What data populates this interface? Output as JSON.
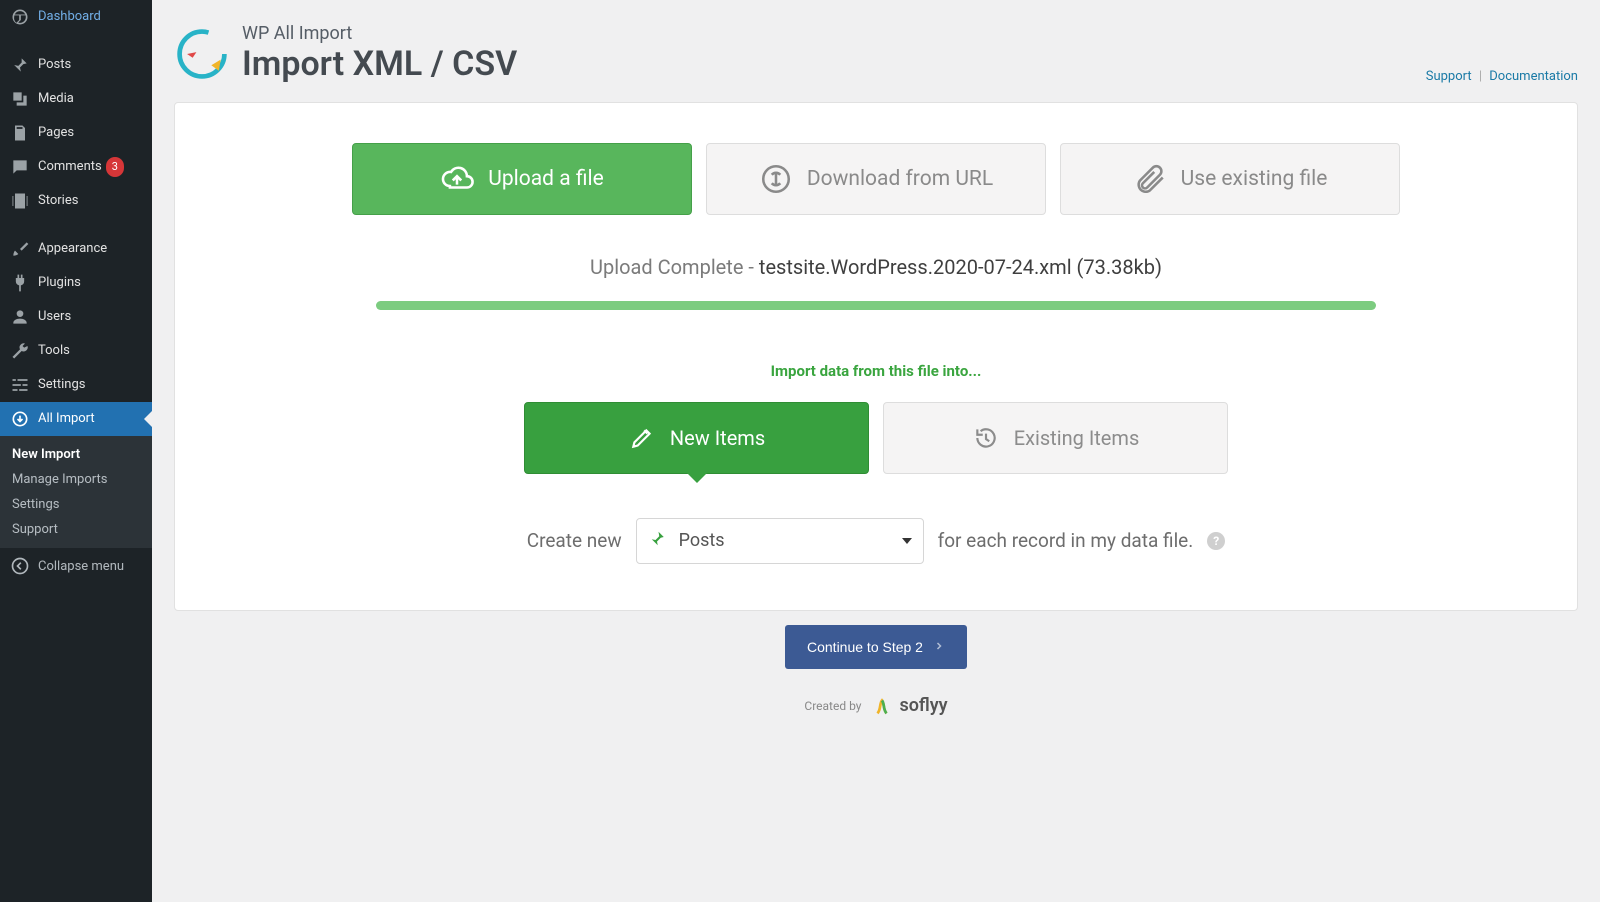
{
  "sidebar": {
    "dashboard": "Dashboard",
    "posts": "Posts",
    "media": "Media",
    "pages": "Pages",
    "comments": "Comments",
    "comments_count": "3",
    "stories": "Stories",
    "appearance": "Appearance",
    "plugins": "Plugins",
    "users": "Users",
    "tools": "Tools",
    "settings": "Settings",
    "all_import": "All Import",
    "sub_new_import": "New Import",
    "sub_manage": "Manage Imports",
    "sub_settings": "Settings",
    "sub_support": "Support",
    "collapse": "Collapse menu"
  },
  "header": {
    "eyebrow": "WP All Import",
    "title": "Import XML / CSV",
    "support": "Support",
    "documentation": "Documentation"
  },
  "tabs": {
    "upload": "Upload a file",
    "download": "Download from URL",
    "existing": "Use existing file"
  },
  "upload": {
    "status_label": "Upload Complete",
    "file_name": "testsite.WordPress.2020-07-24.xml",
    "file_size": "73.38kb",
    "progress_percent": 100
  },
  "into": {
    "label": "Import data from this file into...",
    "new_items": "New Items",
    "existing_items": "Existing Items"
  },
  "create": {
    "prefix": "Create new",
    "selected": "Posts",
    "suffix": "for each record in my data file."
  },
  "continue_label": "Continue to Step 2",
  "footer": {
    "created_by": "Created by",
    "brand": "soflyy"
  }
}
